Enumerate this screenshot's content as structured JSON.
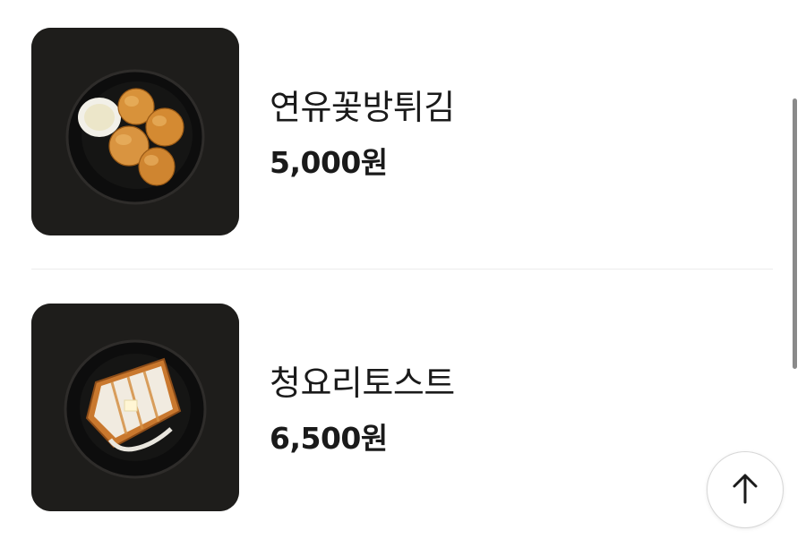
{
  "menu": {
    "items": [
      {
        "name": "연유꽃방튀김",
        "price": "5,000원",
        "image": "fried-milk-buns-plate"
      },
      {
        "name": "청요리토스트",
        "price": "6,500원",
        "image": "glazed-toast-plate"
      }
    ]
  },
  "controls": {
    "scroll_top_icon": "arrow-up-icon"
  },
  "colors": {
    "text": "#1a1a1a",
    "thumbnail_bg": "#1e1d1b",
    "divider": "#ececec",
    "scrollbar": "#8a8a8a"
  }
}
